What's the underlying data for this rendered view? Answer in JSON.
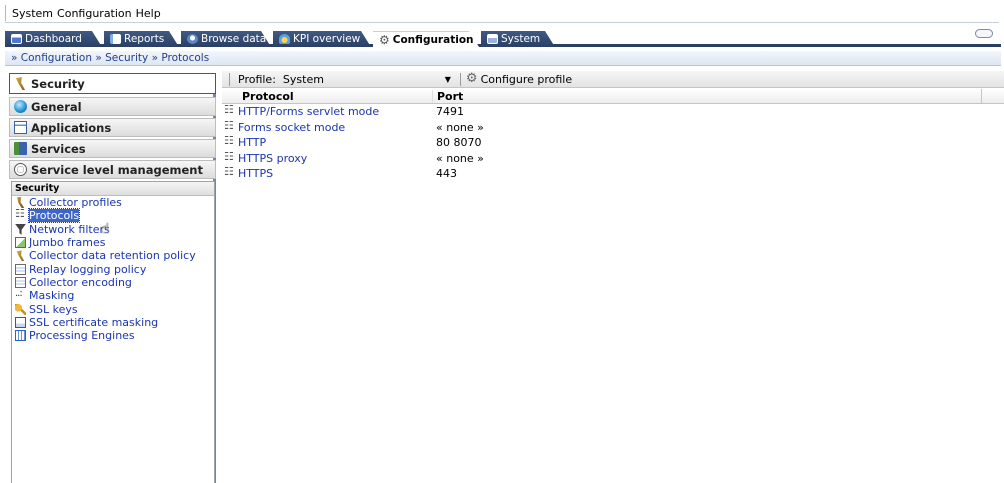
{
  "menubar": {
    "items": [
      "System",
      "Configuration",
      "Help"
    ]
  },
  "tabs": [
    {
      "label": "Dashboard",
      "icon": "dashboard-icon"
    },
    {
      "label": "Reports",
      "icon": "reports-icon"
    },
    {
      "label": "Browse data",
      "icon": "browse-data-icon"
    },
    {
      "label": "KPI overview",
      "icon": "kpi-icon"
    },
    {
      "label": "Configuration",
      "icon": "gear-icon",
      "active": true
    },
    {
      "label": "System",
      "icon": "system-icon"
    }
  ],
  "breadcrumb": {
    "items": [
      "Configuration",
      "Security",
      "Protocols"
    ],
    "separator": "»"
  },
  "sidebar": {
    "categories": [
      {
        "label": "Security",
        "active": true
      },
      {
        "label": "General"
      },
      {
        "label": "Applications"
      },
      {
        "label": "Services"
      },
      {
        "label": "Service level management"
      }
    ],
    "section_title": "Security",
    "items": [
      "Collector profiles",
      "Protocols",
      "Network filters",
      "Jumbo frames",
      "Collector data retention policy",
      "Replay logging policy",
      "Collector encoding",
      "Masking",
      "SSL keys",
      "SSL certificate masking",
      "Processing Engines"
    ],
    "selected_item": "Protocols"
  },
  "profile": {
    "label": "Profile:",
    "value": "System",
    "configure_label": "Configure profile"
  },
  "table": {
    "columns": [
      "Protocol",
      "Port"
    ],
    "rows": [
      {
        "protocol": "HTTP/Forms servlet mode",
        "port": "7491"
      },
      {
        "protocol": "Forms socket mode",
        "port": "« none »"
      },
      {
        "protocol": "HTTP",
        "port": "80 8070"
      },
      {
        "protocol": "HTTPS proxy",
        "port": "« none »"
      },
      {
        "protocol": "HTTPS",
        "port": "443"
      }
    ]
  },
  "colors": {
    "tab_bar": "#2b3f63",
    "link": "#1b35b0",
    "sidebar_border": "#6f86ad",
    "selection": "#3d66c8"
  }
}
